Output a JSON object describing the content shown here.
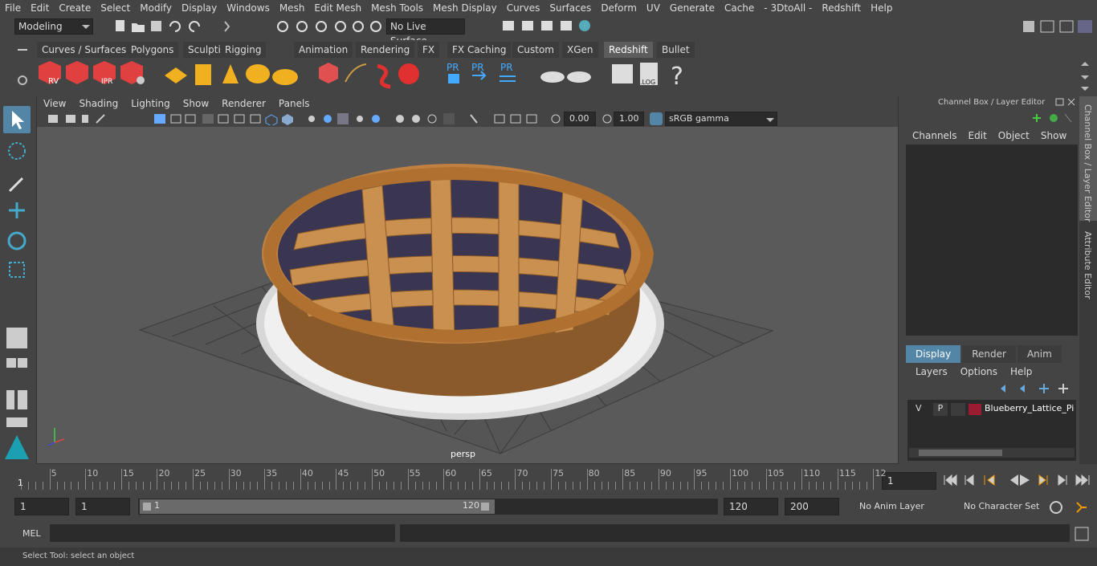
{
  "menu": [
    "File",
    "Edit",
    "Create",
    "Select",
    "Modify",
    "Display",
    "Windows",
    "Mesh",
    "Edit Mesh",
    "Mesh Tools",
    "Mesh Display",
    "Curves",
    "Surfaces",
    "Deform",
    "UV",
    "Generate",
    "Cache",
    "- 3DtoAll -",
    "Redshift",
    "Help"
  ],
  "status": {
    "mode": "Modeling",
    "live_surface": "No Live Surface"
  },
  "shelf_tabs": [
    "Curves / Surfaces",
    "Polygons",
    "Sculpting",
    "Rigging",
    "Animation",
    "Rendering",
    "FX",
    "FX Caching",
    "Custom",
    "XGen",
    "Redshift",
    "Bullet"
  ],
  "shelf_active": "Redshift",
  "shelf_labels": {
    "rv": "RV",
    "ipr": "IPR",
    "pr1": "PR",
    "pr2": "PR",
    "pr3": "PR",
    "log": ".LOG",
    "help": "?"
  },
  "viewport": {
    "menu": [
      "View",
      "Shading",
      "Lighting",
      "Show",
      "Renderer",
      "Panels"
    ],
    "exposure": "0.00",
    "gamma": "1.00",
    "colorspace": "sRGB gamma",
    "camera": "persp"
  },
  "channel_box": {
    "title": "Channel Box / Layer Editor",
    "menu": [
      "Channels",
      "Edit",
      "Object",
      "Show"
    ],
    "layer_tabs": [
      "Display",
      "Render",
      "Anim"
    ],
    "layer_tab_active": "Display",
    "layer_menu": [
      "Layers",
      "Options",
      "Help"
    ],
    "layer": {
      "v": "V",
      "p": "P",
      "name": "Blueberry_Lattice_Pie_V",
      "color": "#9b1b30"
    }
  },
  "side_tabs": [
    "Channel Box / Layer Editor",
    "Attribute Editor"
  ],
  "timeline": {
    "ticks": [
      "5",
      "10",
      "15",
      "20",
      "25",
      "30",
      "35",
      "40",
      "45",
      "50",
      "55",
      "60",
      "65",
      "70",
      "75",
      "80",
      "85",
      "90",
      "95",
      "100",
      "105",
      "110",
      "115",
      "12"
    ],
    "start_marker": "1",
    "current_frame": "1"
  },
  "range": {
    "start": "1",
    "start2": "1",
    "slider_start": "1",
    "slider_end": "120",
    "end": "120",
    "end2": "200",
    "anim_layer": "No Anim Layer",
    "char_set": "No Character Set"
  },
  "cmd": {
    "label": "MEL"
  },
  "help_line": "Select Tool: select an object",
  "colors": {
    "bg": "#444444",
    "field": "#2b2b2b",
    "accent": "#5285a6",
    "viewport": "#5a5a5a"
  }
}
